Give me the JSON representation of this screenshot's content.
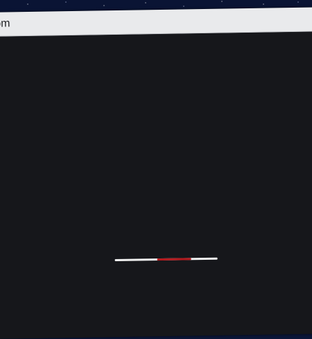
{
  "window": {
    "title_visible": "om"
  },
  "loader": {
    "track_color": "#f2f2f2",
    "fill_color": "#b3191d",
    "fill_start_fraction": 0.41,
    "fill_fraction": 0.33
  },
  "colors": {
    "content_background": "#16171b",
    "titlebar_background": "#e9eaec",
    "wallpaper": "#0b1638"
  }
}
